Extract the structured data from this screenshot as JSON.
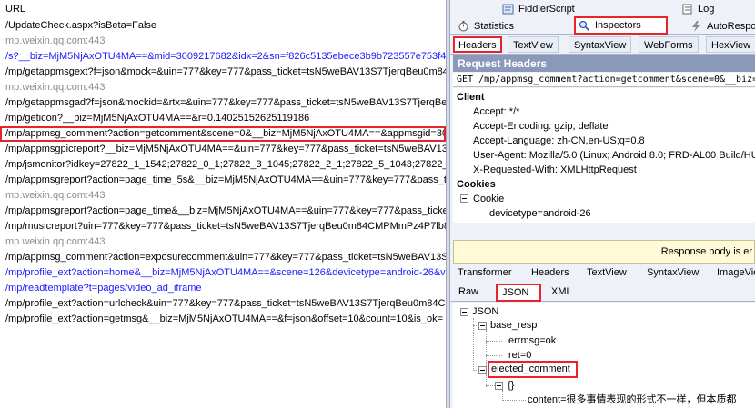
{
  "sessions": {
    "header": "URL",
    "rows": [
      {
        "text": "/UpdateCheck.aspx?isBeta=False",
        "kind": "normal"
      },
      {
        "text": "mp.weixin.qq.com:443",
        "kind": "gray"
      },
      {
        "text": "/s?__biz=MjM5NjAxOTU4MA==&mid=3009217682&idx=2&sn=f826c5135ebece3b9b723557e753f40",
        "kind": "blue"
      },
      {
        "text": "/mp/getappmsgext?f=json&mock=&uin=777&key=777&pass_ticket=tsN5weBAV13S7TjerqBeu0m84C",
        "kind": "normal"
      },
      {
        "text": "mp.weixin.qq.com:443",
        "kind": "gray"
      },
      {
        "text": "/mp/getappmsgad?f=json&mockid=&rtx=&uin=777&key=777&pass_ticket=tsN5weBAV13S7TjerqBeu",
        "kind": "normal"
      },
      {
        "text": "/mp/geticon?__biz=MjM5NjAxOTU4MA==&r=0.14025152625119186",
        "kind": "normal"
      },
      {
        "text": "/mp/appmsg_comment?action=getcomment&scene=0&__biz=MjM5NjAxOTU4MA==&appmsgid=300",
        "kind": "sel"
      },
      {
        "text": "/mp/appmsgpicreport?__biz=MjM5NjAxOTU4MA==&uin=777&key=777&pass_ticket=tsN5weBAV13S",
        "kind": "normal"
      },
      {
        "text": "/mp/jsmonitor?idkey=27822_1_1542;27822_0_1;27822_3_1045;27822_2_1;27822_5_1043;27822_",
        "kind": "normal"
      },
      {
        "text": "/mp/appmsgreport?action=page_time_5s&__biz=MjM5NjAxOTU4MA==&uin=777&key=777&pass_ti",
        "kind": "normal"
      },
      {
        "text": "mp.weixin.qq.com:443",
        "kind": "gray"
      },
      {
        "text": "/mp/appmsgreport?action=page_time&__biz=MjM5NjAxOTU4MA==&uin=777&key=777&pass_ticke",
        "kind": "normal"
      },
      {
        "text": "/mp/musicreport?uin=777&key=777&pass_ticket=tsN5weBAV13S7TjerqBeu0m84CMPMmPz4P7lb8v",
        "kind": "normal"
      },
      {
        "text": "mp.weixin.qq.com:443",
        "kind": "gray"
      },
      {
        "text": "/mp/appmsg_comment?action=exposurecomment&uin=777&key=777&pass_ticket=tsN5weBAV13S",
        "kind": "normal"
      },
      {
        "text": "/mp/profile_ext?action=home&__biz=MjM5NjAxOTU4MA==&scene=126&devicetype=android-26&v",
        "kind": "blue"
      },
      {
        "text": "/mp/readtemplate?t=pages/video_ad_iframe",
        "kind": "blue"
      },
      {
        "text": "/mp/profile_ext?action=urlcheck&uin=777&key=777&pass_ticket=tsN5weBAV13S7TjerqBeu0m84CM",
        "kind": "normal"
      },
      {
        "text": "/mp/profile_ext?action=getmsg&__biz=MjM5NjAxOTU4MA==&f=json&offset=10&count=10&is_ok=",
        "kind": "normal"
      }
    ]
  },
  "top_tabs": {
    "fiddlerscript": "FiddlerScript",
    "log": "Log",
    "statistics": "Statistics",
    "inspectors": "Inspectors",
    "autoresponder": "AutoRespo"
  },
  "request_tabs": [
    "Headers",
    "TextView",
    "SyntaxView",
    "WebForms",
    "HexView"
  ],
  "request_headers": {
    "title": "Request Headers",
    "request_line": "GET /mp/appmsg_comment?action=getcomment&scene=0&__biz=",
    "client_label": "Client",
    "client_items": [
      "Accept: */*",
      "Accept-Encoding: gzip, deflate",
      "Accept-Language: zh-CN,en-US;q=0.8",
      "User-Agent: Mozilla/5.0 (Linux; Android 8.0; FRD-AL00 Build/HU",
      "X-Requested-With: XMLHttpRequest"
    ],
    "cookies_label": "Cookies",
    "cookie_label": "Cookie",
    "cookie_items": [
      "devicetype=android-26"
    ]
  },
  "response": {
    "notice": "Response body is er",
    "tabs": [
      "Transformer",
      "Headers",
      "TextView",
      "SyntaxView",
      "ImageVie"
    ],
    "view_tabs": [
      "Raw",
      "JSON",
      "XML"
    ],
    "json": {
      "root": "JSON",
      "base_resp": "base_resp",
      "errmsg": "errmsg=ok",
      "ret": "ret=0",
      "elected_comment": "elected_comment",
      "obj": "{}",
      "content": "content=很多事情表现的形式不一样，但本质都"
    }
  },
  "colors": {
    "highlight": "#e8232c",
    "blue_text": "#1a1aff",
    "gray_text": "#8c8c8c",
    "header_bar": "#8a99b9"
  }
}
